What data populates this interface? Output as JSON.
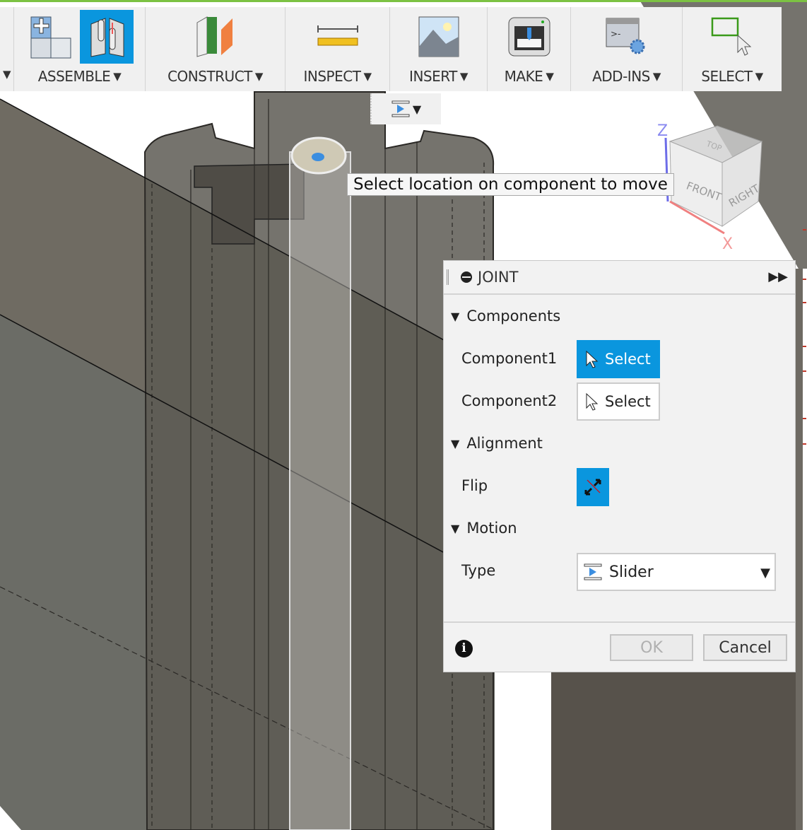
{
  "toolbar": {
    "groups": [
      {
        "label": "ASSEMBLE",
        "icons": [
          "new-component-icon",
          "joint-icon"
        ],
        "active_icon": "joint-icon"
      },
      {
        "label": "CONSTRUCT",
        "icons": [
          "construct-plane-icon"
        ]
      },
      {
        "label": "INSPECT",
        "icons": [
          "measure-ruler-icon"
        ]
      },
      {
        "label": "INSERT",
        "icons": [
          "insert-image-icon"
        ]
      },
      {
        "label": "MAKE",
        "icons": [
          "3d-print-icon"
        ]
      },
      {
        "label": "ADD-INS",
        "icons": [
          "scripts-addins-icon"
        ]
      },
      {
        "label": "SELECT",
        "icons": [
          "select-window-icon"
        ]
      }
    ]
  },
  "viewport": {
    "tooltip": "Select location on component to move",
    "viewcube": {
      "faces": [
        "FRONT",
        "RIGHT",
        "TOP"
      ],
      "axes": [
        "Z",
        "X"
      ]
    }
  },
  "joint_dialog": {
    "title": "JOINT",
    "sections": {
      "components": "Components",
      "alignment": "Alignment",
      "motion": "Motion"
    },
    "component1": {
      "label": "Component1",
      "button": "Select",
      "active": true
    },
    "component2": {
      "label": "Component2",
      "button": "Select",
      "active": false
    },
    "flip_label": "Flip",
    "type_label": "Type",
    "type_value": "Slider",
    "ok": "OK",
    "cancel": "Cancel"
  },
  "colors": {
    "accent": "#0a96de",
    "ribbon_top": "#7cc243"
  }
}
